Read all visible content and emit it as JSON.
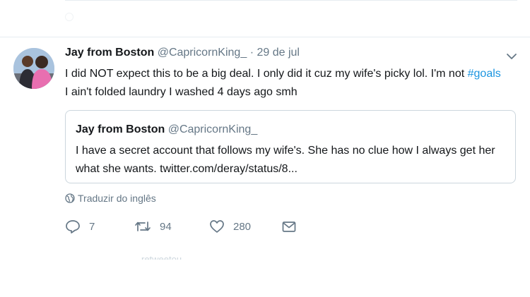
{
  "tweet": {
    "author_name": "Jay from Boston",
    "author_handle": "@CapricornKing_",
    "separator": "·",
    "date": "29 de jul",
    "text_before": "I did NOT expect this to be a big deal. I only did it cuz my wife's picky lol. I'm not ",
    "hashtag": "#goals",
    "text_after": " I ain't folded laundry I washed 4 days ago smh",
    "quoted": {
      "author_name": "Jay from Boston",
      "author_handle": "@CapricornKing_",
      "text": "I have a secret account that follows my wife's. She has no clue how I always get her what she wants. twitter.com/deray/status/8..."
    },
    "translate_label": "Traduzir do inglês",
    "actions": {
      "reply_count": "7",
      "retweet_count": "94",
      "like_count": "280"
    }
  },
  "next_tweet": {
    "context_label": "retweetou"
  },
  "colors": {
    "link": "#1b95e0",
    "secondary_text": "#657786",
    "border": "#ccd6dd"
  }
}
